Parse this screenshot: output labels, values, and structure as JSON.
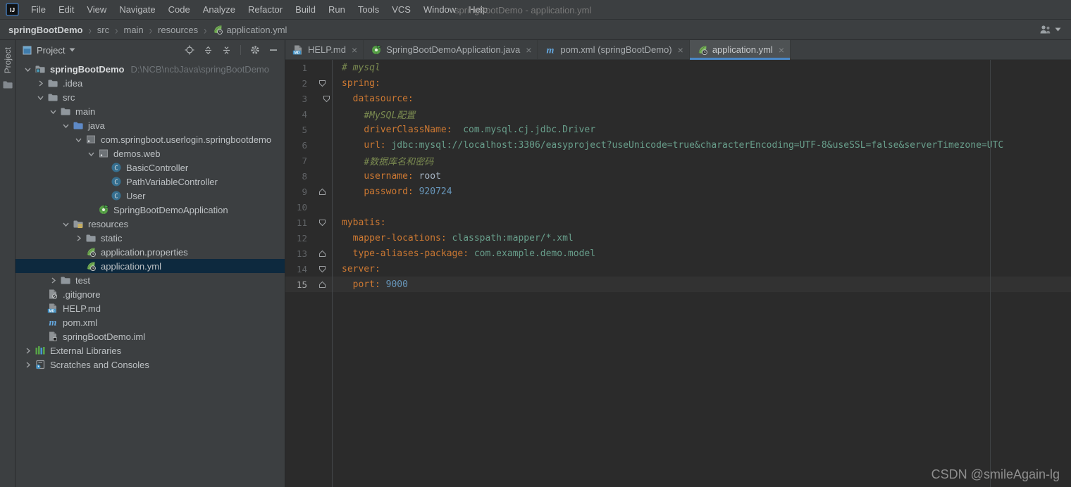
{
  "window": {
    "title": "springBootDemo - application.yml"
  },
  "menu": [
    "File",
    "Edit",
    "View",
    "Navigate",
    "Code",
    "Analyze",
    "Refactor",
    "Build",
    "Run",
    "Tools",
    "VCS",
    "Window",
    "Help"
  ],
  "breadcrumb": [
    "springBootDemo",
    "src",
    "main",
    "resources",
    "application.yml"
  ],
  "toolstrip": {
    "label": "Project"
  },
  "panel": {
    "title": "Project",
    "actions": [
      "locate",
      "expand-all",
      "collapse-all",
      "settings",
      "hide"
    ]
  },
  "tree": [
    {
      "label": "springBootDemo",
      "hint": "D:\\NCB\\ncbJava\\springBootDemo",
      "indent": 0,
      "chevron": "down",
      "icon": "project-folder",
      "bold": true
    },
    {
      "label": ".idea",
      "indent": 1,
      "chevron": "right",
      "icon": "folder"
    },
    {
      "label": "src",
      "indent": 1,
      "chevron": "down",
      "icon": "folder"
    },
    {
      "label": "main",
      "indent": 2,
      "chevron": "down",
      "icon": "folder"
    },
    {
      "label": "java",
      "indent": 3,
      "chevron": "down",
      "icon": "folder-java"
    },
    {
      "label": "com.springboot.userlogin.springbootdemo",
      "indent": 4,
      "chevron": "down",
      "icon": "package"
    },
    {
      "label": "demos.web",
      "indent": 5,
      "chevron": "down",
      "icon": "package"
    },
    {
      "label": "BasicController",
      "indent": 6,
      "chevron": null,
      "icon": "class"
    },
    {
      "label": "PathVariableController",
      "indent": 6,
      "chevron": null,
      "icon": "class"
    },
    {
      "label": "User",
      "indent": 6,
      "chevron": null,
      "icon": "class"
    },
    {
      "label": "SpringBootDemoApplication",
      "indent": 5,
      "chevron": null,
      "icon": "springboot"
    },
    {
      "label": "resources",
      "indent": 3,
      "chevron": "down",
      "icon": "folder-resources"
    },
    {
      "label": "static",
      "indent": 4,
      "chevron": "right",
      "icon": "folder"
    },
    {
      "label": "application.properties",
      "indent": 4,
      "chevron": null,
      "icon": "spring"
    },
    {
      "label": "application.yml",
      "indent": 4,
      "chevron": null,
      "icon": "spring",
      "selected": true
    },
    {
      "label": "test",
      "indent": 2,
      "chevron": "right",
      "icon": "folder"
    },
    {
      "label": ".gitignore",
      "indent": 1,
      "chevron": null,
      "icon": "gitignore"
    },
    {
      "label": "HELP.md",
      "indent": 1,
      "chevron": null,
      "icon": "markdown"
    },
    {
      "label": "pom.xml",
      "indent": 1,
      "chevron": null,
      "icon": "maven"
    },
    {
      "label": "springBootDemo.iml",
      "indent": 1,
      "chevron": null,
      "icon": "iml"
    },
    {
      "label": "External Libraries",
      "indent": 0,
      "chevron": "right",
      "icon": "libraries"
    },
    {
      "label": "Scratches and Consoles",
      "indent": 0,
      "chevron": "right",
      "icon": "scratches"
    }
  ],
  "tabs": [
    {
      "label": "HELP.md",
      "icon": "markdown",
      "active": false
    },
    {
      "label": "SpringBootDemoApplication.java",
      "icon": "springboot",
      "active": false
    },
    {
      "label": "pom.xml (springBootDemo)",
      "icon": "maven",
      "active": false
    },
    {
      "label": "application.yml",
      "icon": "spring",
      "active": true
    }
  ],
  "code": {
    "lines": [
      {
        "n": 1,
        "fold": null,
        "segs": [
          {
            "t": "# mysql",
            "c": "comment"
          }
        ]
      },
      {
        "n": 2,
        "fold": "start",
        "nest": 0,
        "segs": [
          {
            "t": "spring:",
            "c": "key"
          }
        ]
      },
      {
        "n": 3,
        "fold": "start",
        "nest": 1,
        "segs": [
          {
            "t": "  ",
            "c": "plain"
          },
          {
            "t": "datasource:",
            "c": "key"
          }
        ]
      },
      {
        "n": 4,
        "fold": null,
        "segs": [
          {
            "t": "    ",
            "c": "plain"
          },
          {
            "t": "#MySQL配置",
            "c": "comment"
          }
        ]
      },
      {
        "n": 5,
        "fold": null,
        "segs": [
          {
            "t": "    ",
            "c": "plain"
          },
          {
            "t": "driverClassName:",
            "c": "key"
          },
          {
            "t": "  com.mysql.cj.jdbc.Driver",
            "c": "value"
          }
        ]
      },
      {
        "n": 6,
        "fold": null,
        "segs": [
          {
            "t": "    ",
            "c": "plain"
          },
          {
            "t": "url:",
            "c": "key"
          },
          {
            "t": " jdbc:mysql://localhost:3306/easyproject?useUnicode=true&characterEncoding=UTF-8&useSSL=false&serverTimezone=UTC",
            "c": "value"
          }
        ]
      },
      {
        "n": 7,
        "fold": null,
        "segs": [
          {
            "t": "    ",
            "c": "plain"
          },
          {
            "t": "#数据库名和密码",
            "c": "comment"
          }
        ]
      },
      {
        "n": 8,
        "fold": null,
        "segs": [
          {
            "t": "    ",
            "c": "plain"
          },
          {
            "t": "username:",
            "c": "key"
          },
          {
            "t": " root",
            "c": "plainval"
          }
        ]
      },
      {
        "n": 9,
        "fold": "end",
        "nest": 0,
        "segs": [
          {
            "t": "    ",
            "c": "plain"
          },
          {
            "t": "password:",
            "c": "key"
          },
          {
            "t": " 920724",
            "c": "number"
          }
        ]
      },
      {
        "n": 10,
        "fold": null,
        "segs": []
      },
      {
        "n": 11,
        "fold": "start",
        "nest": 0,
        "segs": [
          {
            "t": "mybatis:",
            "c": "key"
          }
        ]
      },
      {
        "n": 12,
        "fold": null,
        "segs": [
          {
            "t": "  ",
            "c": "plain"
          },
          {
            "t": "mapper-locations:",
            "c": "key"
          },
          {
            "t": " classpath:mapper/*.xml",
            "c": "value"
          }
        ]
      },
      {
        "n": 13,
        "fold": "end",
        "nest": 0,
        "segs": [
          {
            "t": "  ",
            "c": "plain"
          },
          {
            "t": "type-aliases-package:",
            "c": "key"
          },
          {
            "t": " com.example.demo.model",
            "c": "value"
          }
        ]
      },
      {
        "n": 14,
        "fold": "start",
        "nest": 0,
        "segs": [
          {
            "t": "server:",
            "c": "key"
          }
        ]
      },
      {
        "n": 15,
        "fold": "end",
        "nest": 0,
        "current": true,
        "segs": [
          {
            "t": "  ",
            "c": "plain"
          },
          {
            "t": "port:",
            "c": "key"
          },
          {
            "t": " 9000",
            "c": "number"
          }
        ]
      }
    ]
  },
  "watermark": "CSDN @smileAgain-lg",
  "colors": {
    "accent": "#4A88C7",
    "selection": "#0D293E",
    "key": "#CC7832",
    "value": "#689E8B",
    "comment": "#7A8A50",
    "number": "#6897BB",
    "plain": "#A9B7C6"
  }
}
